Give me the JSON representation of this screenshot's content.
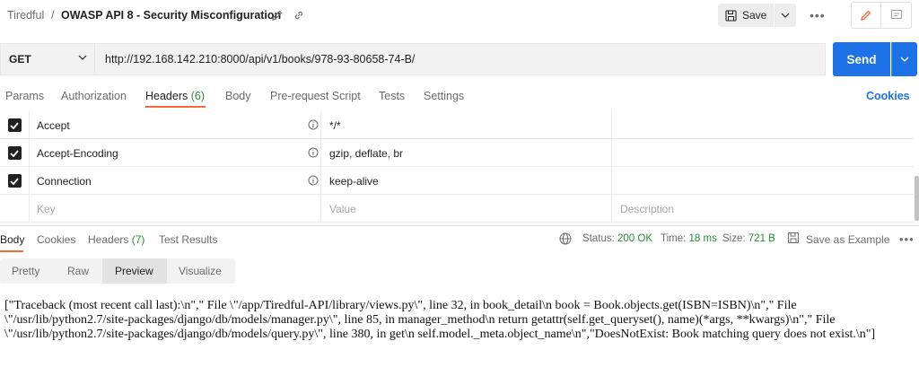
{
  "header": {
    "workspace": "Tiredful",
    "separator": "/",
    "request_name": "OWASP API 8 - Security Misconfiguration",
    "save_label": "Save",
    "more_label": "•••"
  },
  "request": {
    "method": "GET",
    "url": "http://192.168.142.210:8000/api/v1/books/978-93-80658-74-B/",
    "send_label": "Send"
  },
  "request_tabs": [
    {
      "label": "Params"
    },
    {
      "label": "Authorization"
    },
    {
      "label": "Headers",
      "count": "(6)"
    },
    {
      "label": "Body"
    },
    {
      "label": "Pre-request Script"
    },
    {
      "label": "Tests"
    },
    {
      "label": "Settings"
    }
  ],
  "cookies_label": "Cookies",
  "headers_table": {
    "rows": [
      {
        "key": "Accept",
        "value": "*/*"
      },
      {
        "key": "Accept-Encoding",
        "value": "gzip, deflate, br"
      },
      {
        "key": "Connection",
        "value": "keep-alive"
      }
    ],
    "placeholder": {
      "key": "Key",
      "value": "Value",
      "description": "Description"
    }
  },
  "response_tabs": [
    {
      "label": "Body"
    },
    {
      "label": "Cookies"
    },
    {
      "label": "Headers",
      "count": "(7)"
    },
    {
      "label": "Test Results"
    }
  ],
  "response_meta": {
    "status_label": "Status:",
    "status_value": "200 OK",
    "time_label": "Time:",
    "time_value": "18 ms",
    "size_label": "Size:",
    "size_value": "721 B",
    "save_example": "Save as Example",
    "more_label": "•••"
  },
  "view_modes": [
    "Pretty",
    "Raw",
    "Preview",
    "Visualize"
  ],
  "response_body": "[\"Traceback (most recent call last):\\n\",\" File \\\"/app/Tiredful-API/library/views.py\\\", line 32, in book_detail\\n book = Book.objects.get(ISBN=ISBN)\\n\",\" File \\\"/usr/lib/python2.7/site-packages/django/db/models/manager.py\\\", line 85, in manager_method\\n return getattr(self.get_queryset(), name)(*args, **kwargs)\\n\",\" File \\\"/usr/lib/python2.7/site-packages/django/db/models/query.py\\\", line 380, in get\\n self.model._meta.object_name\\n\",\"DoesNotExist: Book matching query does not exist.\\n\"]",
  "colors": {
    "accent": "#1d72e8",
    "tab_underline": "#f26b3a",
    "status_ok": "#2a8c3a"
  }
}
